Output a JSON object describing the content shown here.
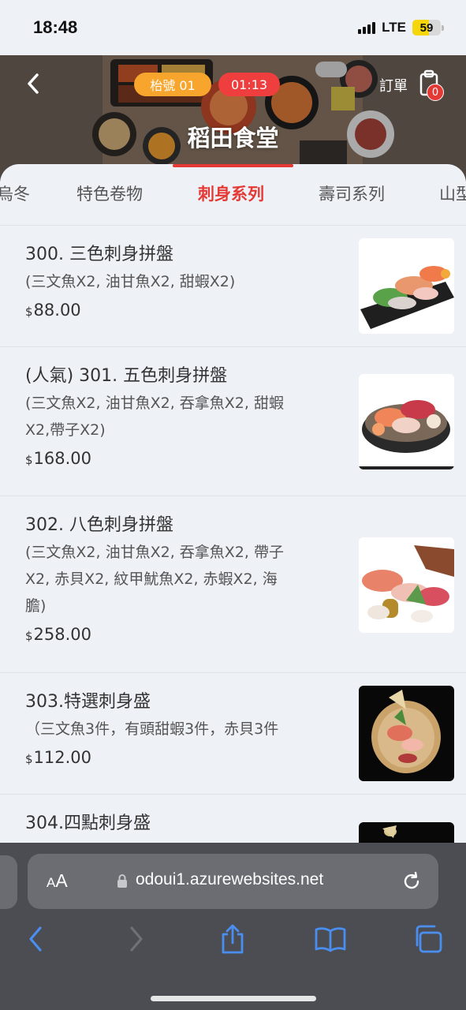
{
  "status_bar": {
    "time": "18:48",
    "network": "LTE",
    "battery": "59",
    "battery_level_percent": 59
  },
  "header": {
    "table_label": "枱號 01",
    "timer": "01:13",
    "order_label": "訂單",
    "cart_count": "0",
    "store_name": "稻田食堂",
    "colors": {
      "table_pill": "#f7a52c",
      "timer_pill": "#ef3e3e",
      "accent": "#e53935"
    }
  },
  "tabs": [
    {
      "label": "烏冬"
    },
    {
      "label": "特色卷物"
    },
    {
      "label": "刺身系列",
      "active": true
    },
    {
      "label": "壽司系列"
    },
    {
      "label": "山型"
    }
  ],
  "menu": {
    "items": [
      {
        "name": "300. 三色刺身拼盤",
        "desc_lines": [
          "(三文魚X2, 油甘魚X2, 甜蝦X2)"
        ],
        "currency": "$",
        "price": "88.00",
        "image_icon": "sashimi-platter-photo"
      },
      {
        "name": "(人氣) 301. 五色刺身拼盤",
        "desc_lines": [
          "(三文魚X2, 油甘魚X2, 吞拿魚X2, 甜蝦",
          "X2,帶子X2)"
        ],
        "currency": "$",
        "price": "168.00",
        "image_icon": "sashimi-bowl-photo"
      },
      {
        "name": "302. 八色刺身拼盤",
        "desc_lines": [
          "(三文魚X2, 油甘魚X2, 吞拿魚X2, 帶子",
          "X2, 赤貝X2, 紋甲魷魚X2,  赤蝦X2, 海",
          "膽)"
        ],
        "currency": "$",
        "price": "258.00",
        "image_icon": "sashimi-deluxe-photo"
      },
      {
        "name": "303.特選刺身盛",
        "desc_lines": [
          "（三文魚3件，有頭甜蝦3件，赤貝3件"
        ],
        "currency": "$",
        "price": "112.00",
        "image_icon": "sashimi-special-photo"
      },
      {
        "name": "304.四點刺身盛",
        "desc_lines": [],
        "currency": "",
        "price": "",
        "image_icon": "sashimi-four-photo"
      }
    ]
  },
  "safari": {
    "aa_small": "A",
    "aa_big": "A",
    "url": "odoui1.azurewebsites.net",
    "icons": [
      "lock-icon",
      "reload-icon",
      "back-icon",
      "forward-icon",
      "share-icon",
      "bookmarks-icon",
      "tabs-icon"
    ]
  }
}
